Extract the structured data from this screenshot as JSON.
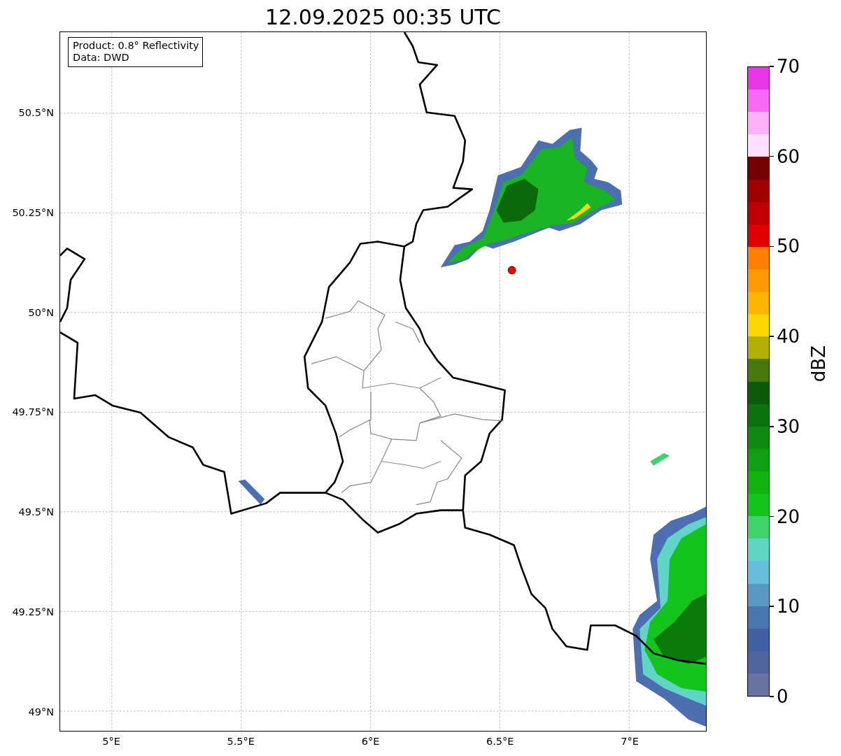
{
  "title": "12.09.2025 00:35 UTC",
  "info_box": [
    "Product: 0.8° Reflectivity",
    "Data: DWD"
  ],
  "map": {
    "lat_labels": [
      "50.5°N",
      "50.25°N",
      "50°N",
      "49.75°N",
      "49.5°N",
      "49.25°N",
      "49°N"
    ],
    "lon_labels": [
      "5°E",
      "5.5°E",
      "6°E",
      "6.5°E",
      "7°E"
    ]
  },
  "colorbar": {
    "label": "dBZ",
    "tick_labels": [
      "70",
      "60",
      "50",
      "40",
      "30",
      "20",
      "10",
      "0"
    ],
    "bins": [
      {
        "color": "#6673a3"
      },
      {
        "color": "#50659e"
      },
      {
        "color": "#4060a3"
      },
      {
        "color": "#4a76b0"
      },
      {
        "color": "#5899c4"
      },
      {
        "color": "#65bfdc"
      },
      {
        "color": "#5fd6c3"
      },
      {
        "color": "#3dd46a"
      },
      {
        "color": "#13c41d"
      },
      {
        "color": "#11b311"
      },
      {
        "color": "#109f10"
      },
      {
        "color": "#0e8a0e"
      },
      {
        "color": "#0b730b"
      },
      {
        "color": "#0a5c0a"
      },
      {
        "color": "#48780a"
      },
      {
        "color": "#b0b000"
      },
      {
        "color": "#ffd700"
      },
      {
        "color": "#ffb400"
      },
      {
        "color": "#ff9900"
      },
      {
        "color": "#ff7f00"
      },
      {
        "color": "#e00000"
      },
      {
        "color": "#c00000"
      },
      {
        "color": "#a00000"
      },
      {
        "color": "#760000"
      },
      {
        "color": "#ffe0fe"
      },
      {
        "color": "#feb0fb"
      },
      {
        "color": "#fb68f6"
      },
      {
        "color": "#e936e8"
      }
    ]
  }
}
